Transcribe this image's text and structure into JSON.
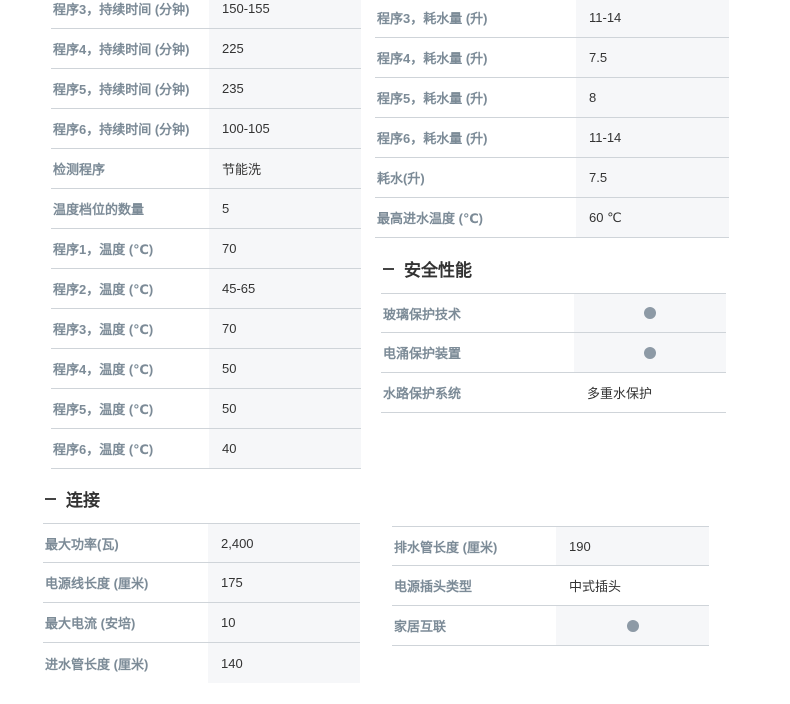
{
  "left_table": [
    {
      "label": "程序3，持续时间 (分钟)",
      "value": "150-155"
    },
    {
      "label": "程序4，持续时间 (分钟)",
      "value": "225"
    },
    {
      "label": "程序5，持续时间 (分钟)",
      "value": "235"
    },
    {
      "label": "程序6，持续时间 (分钟)",
      "value": "100-105"
    },
    {
      "label": "检测程序",
      "value": "节能洗"
    },
    {
      "label": "温度档位的数量",
      "value": "5"
    },
    {
      "label": "程序1，温度 (℃)",
      "value": "70"
    },
    {
      "label": "程序2，温度 (℃)",
      "value": "45-65"
    },
    {
      "label": "程序3，温度 (℃)",
      "value": "70"
    },
    {
      "label": "程序4，温度 (℃)",
      "value": "50"
    },
    {
      "label": "程序5，温度 (℃)",
      "value": "50"
    },
    {
      "label": "程序6，温度 (℃)",
      "value": "40"
    }
  ],
  "right_table": [
    {
      "label": "程序3，耗水量 (升)",
      "value": "11-14"
    },
    {
      "label": "程序4，耗水量 (升)",
      "value": "7.5"
    },
    {
      "label": "程序5，耗水量 (升)",
      "value": "8"
    },
    {
      "label": "程序6，耗水量 (升)",
      "value": "11-14"
    },
    {
      "label": "耗水(升)",
      "value": "7.5"
    },
    {
      "label": "最高进水温度 (℃)",
      "value": "60 ℃"
    }
  ],
  "safety": {
    "title": "安全性能",
    "rows": [
      {
        "label": "玻璃保护技术",
        "value": null,
        "indicator": "dot"
      },
      {
        "label": "电涌保护装置",
        "value": null,
        "indicator": "dot"
      },
      {
        "label": "水路保护系统",
        "value": "多重水保护"
      }
    ]
  },
  "connection": {
    "title": "连接",
    "left_rows": [
      {
        "label": "最大功率(瓦)",
        "value": "2,400"
      },
      {
        "label": "电源线长度 (厘米)",
        "value": "175"
      },
      {
        "label": "最大电流 (安培)",
        "value": "10"
      },
      {
        "label": "进水管长度 (厘米)",
        "value": "140"
      }
    ],
    "right_rows": [
      {
        "label": "排水管长度 (厘米)",
        "value": "190"
      },
      {
        "label": "电源插头类型",
        "value": "中式插头"
      },
      {
        "label": "家居互联",
        "value": null,
        "indicator": "dot"
      }
    ]
  },
  "colors": {
    "label_text": "#7c8b97",
    "value_bg": "#f6f7f9",
    "divider": "#cfd4d9",
    "dot": "#8d9aa6"
  }
}
